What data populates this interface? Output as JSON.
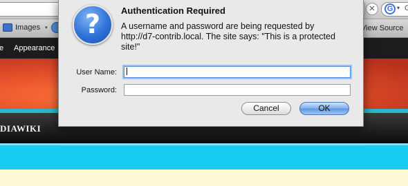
{
  "browser": {
    "toolbar": {
      "clear_url_glyph": "✕",
      "search_engine_letter": "G",
      "search_engine_caret": "▾",
      "search_prefix": "G"
    },
    "bookmarks": {
      "images_label": "Images",
      "images_caret": "▾",
      "view_source_label": "View Source",
      "view_source_caret": "▾"
    }
  },
  "site": {
    "admin_menu": [
      "e",
      "Appearance"
    ],
    "site_name": "DIAWIKI"
  },
  "dialog": {
    "title": "Authentication Required",
    "message": "A username and password are being requested by http://d7-contrib.local. The site says: \"This is a protected site!\"",
    "username_label": "User Name:",
    "username_value": "",
    "password_label": "Password:",
    "password_value": "",
    "cancel_label": "Cancel",
    "ok_label": "OK",
    "icon": "question-mark-icon"
  }
}
